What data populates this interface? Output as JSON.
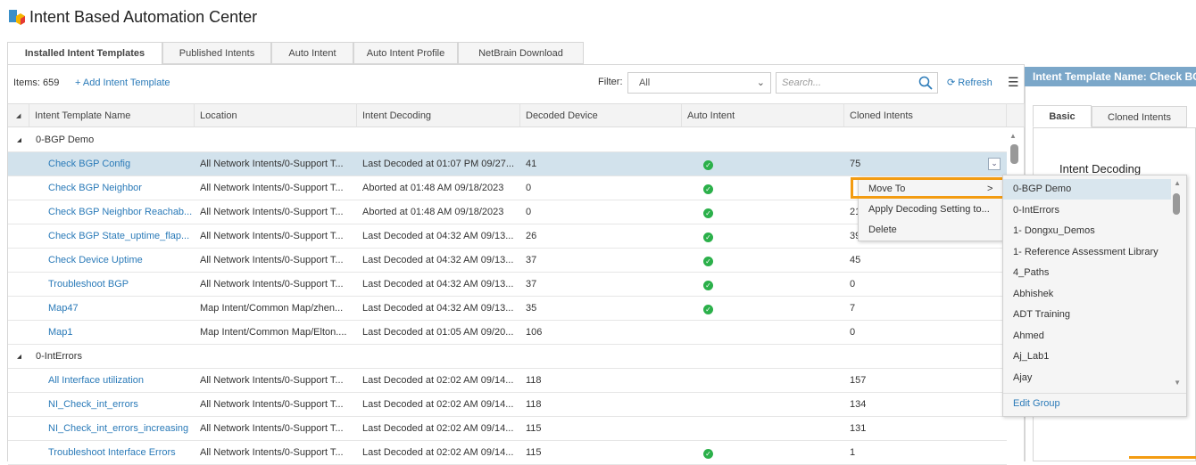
{
  "app": {
    "title": "Intent Based Automation Center"
  },
  "tabs": [
    "Installed Intent Templates",
    "Published Intents",
    "Auto Intent",
    "Auto Intent Profile",
    "NetBrain Download"
  ],
  "toolbar": {
    "items_label": "Items: 659",
    "add_label": "+ Add Intent Template",
    "filter_label": "Filter:",
    "filter_value": "All",
    "search_placeholder": "Search...",
    "refresh_label": "Refresh"
  },
  "columns": [
    "Intent Template Name",
    "Location",
    "Intent Decoding",
    "Decoded Device",
    "Auto Intent",
    "Cloned Intents"
  ],
  "groups": [
    {
      "name": "0-BGP Demo",
      "rows": [
        {
          "name": "Check BGP Config",
          "location": "All Network Intents/0-Support T...",
          "decoding": "Last Decoded at 01:07 PM 09/27...",
          "device": "41",
          "auto": true,
          "cloned": "75"
        },
        {
          "name": "Check BGP Neighbor",
          "location": "All Network Intents/0-Support T...",
          "decoding": "Aborted at 01:48 AM 09/18/2023",
          "device": "0",
          "auto": true,
          "cloned": ""
        },
        {
          "name": "Check BGP Neighbor Reachab...",
          "location": "All Network Intents/0-Support T...",
          "decoding": "Aborted at 01:48 AM 09/18/2023",
          "device": "0",
          "auto": true,
          "cloned": "21"
        },
        {
          "name": "Check BGP State_uptime_flap...",
          "location": "All Network Intents/0-Support T...",
          "decoding": "Last Decoded at 04:32 AM 09/13...",
          "device": "26",
          "auto": true,
          "cloned": "39"
        },
        {
          "name": "Check Device Uptime",
          "location": "All Network Intents/0-Support T...",
          "decoding": "Last Decoded at 04:32 AM 09/13...",
          "device": "37",
          "auto": true,
          "cloned": "45"
        },
        {
          "name": "Troubleshoot BGP",
          "location": "All Network Intents/0-Support T...",
          "decoding": "Last Decoded at 04:32 AM 09/13...",
          "device": "37",
          "auto": true,
          "cloned": "0"
        },
        {
          "name": "Map47",
          "location": "Map Intent/Common Map/zhen...",
          "decoding": "Last Decoded at 04:32 AM 09/13...",
          "device": "35",
          "auto": true,
          "cloned": "7"
        },
        {
          "name": "Map1",
          "location": "Map Intent/Common Map/Elton....",
          "decoding": "Last Decoded at 01:05 AM 09/20...",
          "device": "106",
          "auto": false,
          "cloned": "0"
        }
      ]
    },
    {
      "name": "0-IntErrors",
      "rows": [
        {
          "name": "All Interface utilization",
          "location": "All Network Intents/0-Support T...",
          "decoding": "Last Decoded at 02:02 AM 09/14...",
          "device": "118",
          "auto": false,
          "cloned": "157"
        },
        {
          "name": "NI_Check_int_errors",
          "location": "All Network Intents/0-Support T...",
          "decoding": "Last Decoded at 02:02 AM 09/14...",
          "device": "118",
          "auto": false,
          "cloned": "134"
        },
        {
          "name": "NI_Check_int_errors_increasing",
          "location": "All Network Intents/0-Support T...",
          "decoding": "Last Decoded at 02:02 AM 09/14...",
          "device": "115",
          "auto": false,
          "cloned": "131"
        },
        {
          "name": "Troubleshoot Interface Errors",
          "location": "All Network Intents/0-Support T...",
          "decoding": "Last Decoded at 02:02 AM 09/14...",
          "device": "115",
          "auto": true,
          "cloned": "1"
        }
      ]
    }
  ],
  "context_menu": [
    "Move To",
    "Apply Decoding Setting to...",
    "Delete"
  ],
  "submenu": {
    "items": [
      "0-BGP Demo",
      "0-IntErrors",
      "1- Dongxu_Demos",
      "1- Reference Assessment Library",
      "4_Paths",
      "Abhishek",
      "ADT Training",
      "Ahmed",
      "Aj_Lab1",
      "Ajay"
    ],
    "edit_label": "Edit Group"
  },
  "right_panel": {
    "header": "Intent Template Name: Check BGP Config",
    "tabs": [
      "Basic",
      "Cloned Intents"
    ],
    "section": "Intent Decoding"
  }
}
